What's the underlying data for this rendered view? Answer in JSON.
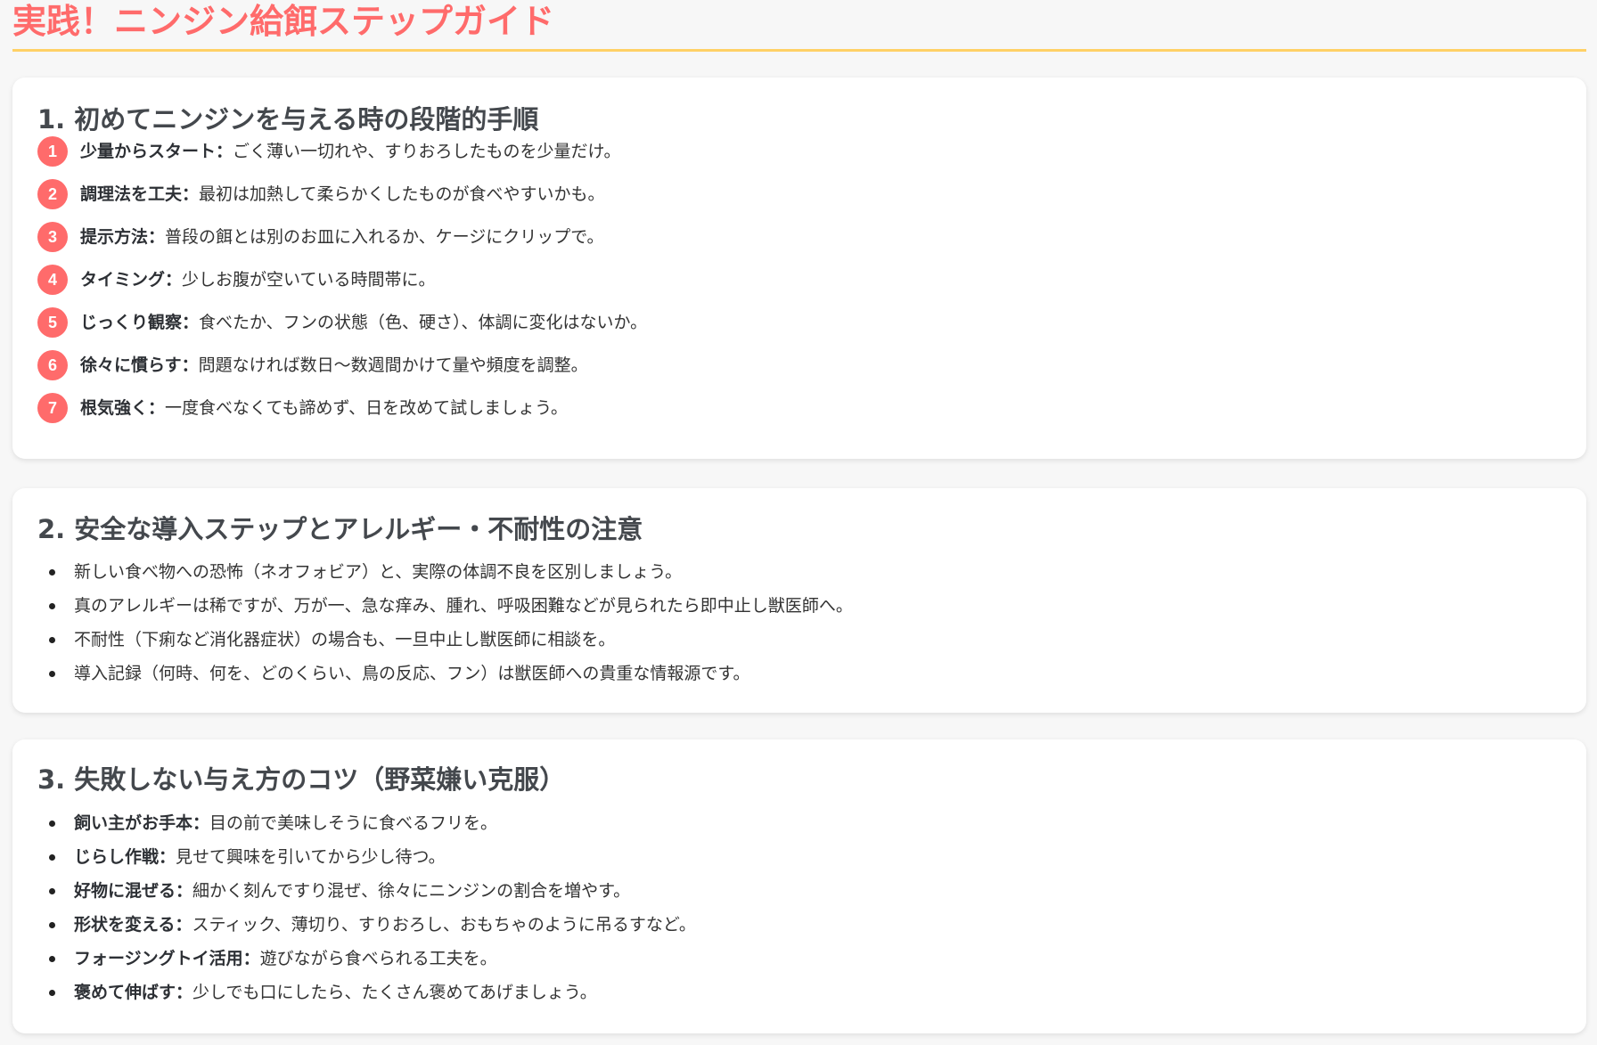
{
  "page": {
    "title": "実践！ニンジン給餌ステップガイド"
  },
  "section1": {
    "title": "1. 初めてニンジンを与える時の段階的手順",
    "steps": [
      {
        "num": "1",
        "label": "少量からスタート：",
        "text": "ごく薄い一切れや、すりおろしたものを少量だけ。"
      },
      {
        "num": "2",
        "label": "調理法を工夫：",
        "text": "最初は加熱して柔らかくしたものが食べやすいかも。"
      },
      {
        "num": "3",
        "label": "提示方法：",
        "text": "普段の餌とは別のお皿に入れるか、ケージにクリップで。"
      },
      {
        "num": "4",
        "label": "タイミング：",
        "text": "少しお腹が空いている時間帯に。"
      },
      {
        "num": "5",
        "label": "じっくり観察：",
        "text": "食べたか、フンの状態（色、硬さ）、体調に変化はないか。"
      },
      {
        "num": "6",
        "label": "徐々に慣らす：",
        "text": "問題なければ数日〜数週間かけて量や頻度を調整。"
      },
      {
        "num": "7",
        "label": "根気強く：",
        "text": "一度食べなくても諦めず、日を改めて試しましょう。"
      }
    ]
  },
  "section2": {
    "title": "2. 安全な導入ステップとアレルギー・不耐性の注意",
    "items": [
      "新しい食べ物への恐怖（ネオフォビア）と、実際の体調不良を区別しましょう。",
      "真のアレルギーは稀ですが、万が一、急な痒み、腫れ、呼吸困難などが見られたら即中止し獣医師へ。",
      "不耐性（下痢など消化器症状）の場合も、一旦中止し獣医師に相談を。",
      "導入記録（何時、何を、どのくらい、鳥の反応、フン）は獣医師への貴重な情報源です。"
    ]
  },
  "section3": {
    "title": "3. 失敗しない与え方のコツ（野菜嫌い克服）",
    "items": [
      {
        "label": "飼い主がお手本：",
        "text": "目の前で美味しそうに食べるフリを。"
      },
      {
        "label": "じらし作戦：",
        "text": "見せて興味を引いてから少し待つ。"
      },
      {
        "label": "好物に混ぜる：",
        "text": "細かく刻んですり混ぜ、徐々にニンジンの割合を増やす。"
      },
      {
        "label": "形状を変える：",
        "text": "スティック、薄切り、すりおろし、おもちゃのように吊るすなど。"
      },
      {
        "label": "フォージングトイ活用：",
        "text": "遊びながら食べられる工夫を。"
      },
      {
        "label": "褒めて伸ばす：",
        "text": "少しでも口にしたら、たくさん褒めてあげましょう。"
      }
    ]
  },
  "colors": {
    "accent": "#ff6b6b",
    "divider": "#ffd166",
    "card_background": "#ffffff",
    "page_background": "#f7f7f7"
  }
}
